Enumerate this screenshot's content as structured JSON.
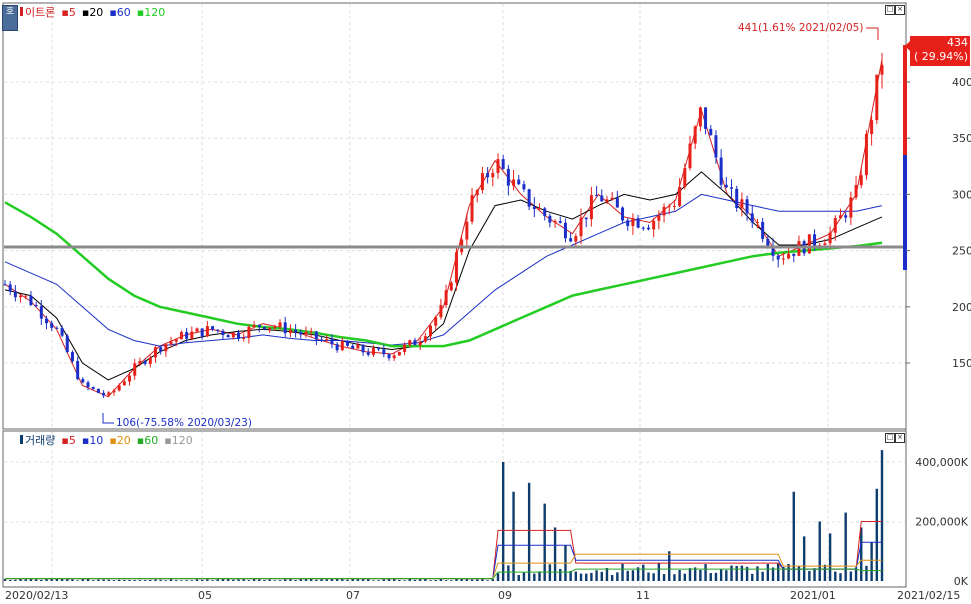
{
  "toolbar": {
    "corner_label": "호"
  },
  "price_panel": {
    "legend": {
      "name": "이트론",
      "ma": [
        "5",
        "20",
        "60",
        "120"
      ]
    },
    "last_price_tag": {
      "value": "434",
      "change": "( 29.94%)"
    },
    "high_annotation": "441(1.61% 2021/02/05)",
    "low_annotation": "106(-75.58% 2020/03/23)",
    "y_ticks": [
      "400",
      "350",
      "300",
      "250",
      "200",
      "150"
    ]
  },
  "volume_panel": {
    "legend": {
      "name": "거래량",
      "ma": [
        "5",
        "10",
        "20",
        "60",
        "120"
      ]
    },
    "y_ticks": [
      "400,000K",
      "200,000K",
      "0K"
    ]
  },
  "x_axis": {
    "labels": [
      "2020/02/13",
      "05",
      "07",
      "09",
      "11",
      "2021/01",
      "2021/02/15"
    ]
  },
  "colors": {
    "up": "#e8201a",
    "down": "#1b2fc8",
    "ma5": "#d42020",
    "ma20": "#000000",
    "ma60": "#1b2fc8",
    "ma120": "#22cc22",
    "volume": "#0d3c6e",
    "support_line": "#888888"
  },
  "chart_data": {
    "type": "candlestick",
    "title": "이트론",
    "price_range": [
      100,
      450
    ],
    "support_level": 253,
    "high": {
      "value": 441,
      "date": "2021/02/05"
    },
    "low": {
      "value": 106,
      "date": "2020/03/23"
    },
    "last_close": 434,
    "series": [
      {
        "name": "5",
        "values": [
          220,
          205,
          180,
          130,
          120,
          145,
          165,
          175,
          180,
          175,
          185,
          180,
          172,
          165,
          160,
          158,
          170,
          200,
          290,
          330,
          300,
          280,
          265,
          300,
          280,
          275,
          295,
          375,
          300,
          280,
          245,
          255,
          265,
          300,
          420
        ]
      },
      {
        "name": "20",
        "values": [
          215,
          210,
          190,
          150,
          135,
          145,
          160,
          170,
          175,
          178,
          180,
          178,
          175,
          170,
          165,
          162,
          165,
          185,
          250,
          290,
          295,
          285,
          278,
          290,
          300,
          295,
          300,
          320,
          300,
          275,
          255,
          255,
          260,
          270,
          280
        ]
      },
      {
        "name": "60",
        "values": [
          240,
          230,
          220,
          200,
          180,
          170,
          165,
          168,
          170,
          172,
          175,
          172,
          170,
          170,
          168,
          166,
          168,
          175,
          195,
          215,
          230,
          245,
          255,
          265,
          275,
          280,
          285,
          300,
          295,
          290,
          285,
          285,
          285,
          285,
          290
        ]
      },
      {
        "name": "120",
        "values": [
          293,
          280,
          265,
          245,
          225,
          210,
          200,
          195,
          190,
          185,
          182,
          180,
          177,
          173,
          170,
          165,
          165,
          165,
          170,
          180,
          190,
          200,
          210,
          215,
          220,
          225,
          230,
          235,
          240,
          245,
          248,
          250,
          252,
          254,
          257
        ]
      }
    ],
    "volume_series_max": 440000
  }
}
